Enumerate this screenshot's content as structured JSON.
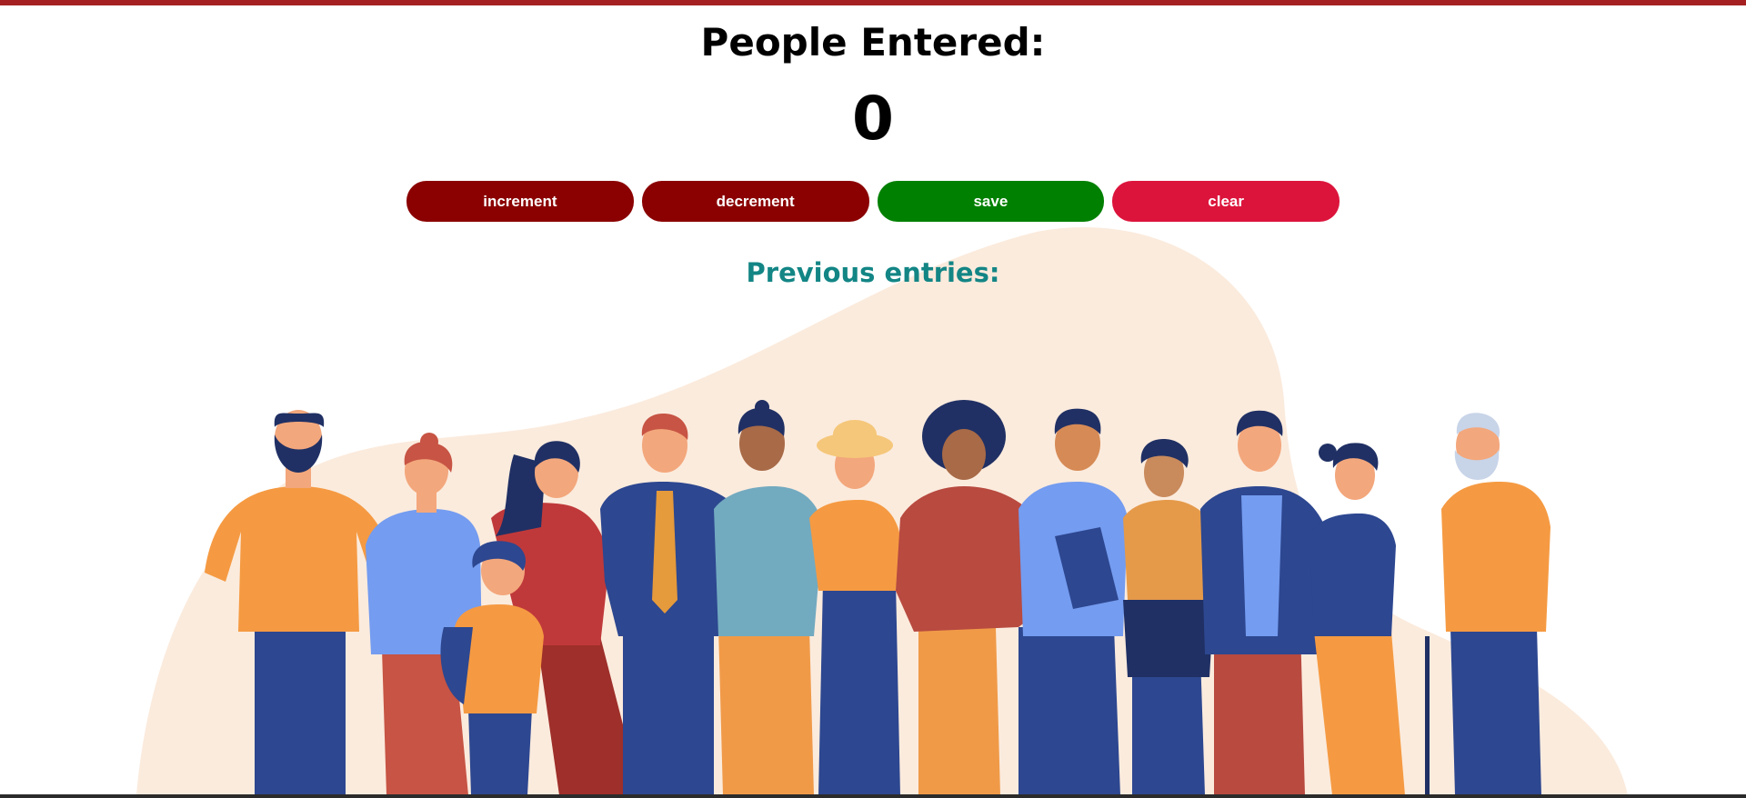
{
  "header": {
    "title": "People Entered:",
    "count": "0"
  },
  "controls": {
    "increment_label": "increment",
    "decrement_label": "decrement",
    "save_label": "save",
    "clear_label": "clear"
  },
  "entries": {
    "label": "Previous entries:",
    "value": ""
  },
  "colors": {
    "top_bar": "#a52121",
    "increment": "#8b0000",
    "decrement": "#8b0000",
    "save": "#008000",
    "clear": "#dc143c",
    "entries_label": "#138585",
    "blob": "#fbebdd"
  },
  "illustration": {
    "icon": "diverse-crowd-illustration"
  }
}
